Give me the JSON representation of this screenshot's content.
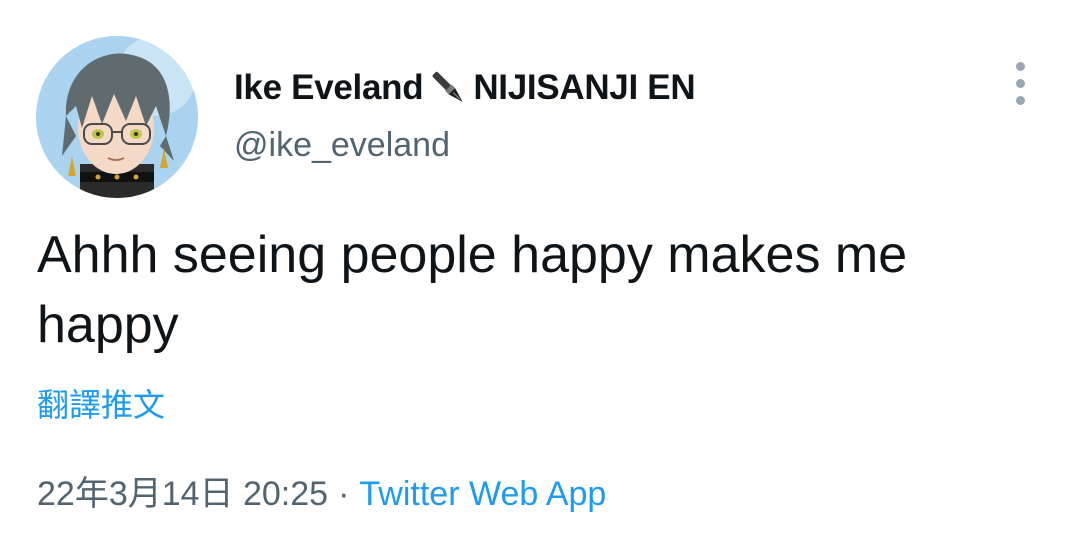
{
  "author": {
    "display_name_part1": "Ike Eveland",
    "display_name_part2": "NIJISANJI EN",
    "handle": "@ike_eveland",
    "name_icon": "fountain-pen-icon"
  },
  "tweet": {
    "text": "Ahhh seeing people happy makes me happy",
    "translate_label": "翻譯推文",
    "timestamp": "22年3月14日 20:25",
    "separator": "·",
    "source": "Twitter Web App"
  },
  "colors": {
    "link": "#1d9bf0",
    "secondary_text": "#536471",
    "primary_text": "#0f1419"
  },
  "icons": {
    "more": "more-vertical-icon"
  }
}
